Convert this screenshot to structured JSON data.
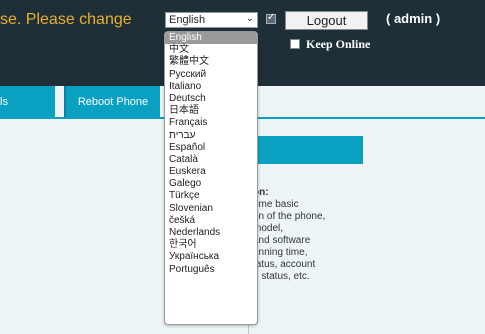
{
  "header": {
    "warning_text": "se. Please change",
    "language_value": "English",
    "dropdown_chevron": "⌄",
    "logout_label": "Logout",
    "user_label": "( admin )",
    "keep_online_label": "Keep Online"
  },
  "tabs": [
    {
      "label": "ls"
    },
    {
      "label": "Reboot Phone"
    }
  ],
  "language_options": [
    "English",
    "中文",
    "繁體中文",
    "Русский",
    "Italiano",
    "Deutsch",
    "日本語",
    "Français",
    "עברית",
    "Español",
    "Català",
    "Euskera",
    "Galego",
    "Türkçe",
    "Slovenian",
    "češká",
    "Nederlands",
    "한국어",
    "Українська",
    "Português"
  ],
  "description": {
    "heading": "on:",
    "lines": [
      "ome basic",
      "on of the phone,",
      "model,",
      "and software",
      "unning time,",
      "tatus, account",
      "n status, etc."
    ]
  },
  "colors": {
    "topbar": "#1f2f38",
    "accent": "#0aa0c2",
    "warning": "#e8b02a"
  }
}
